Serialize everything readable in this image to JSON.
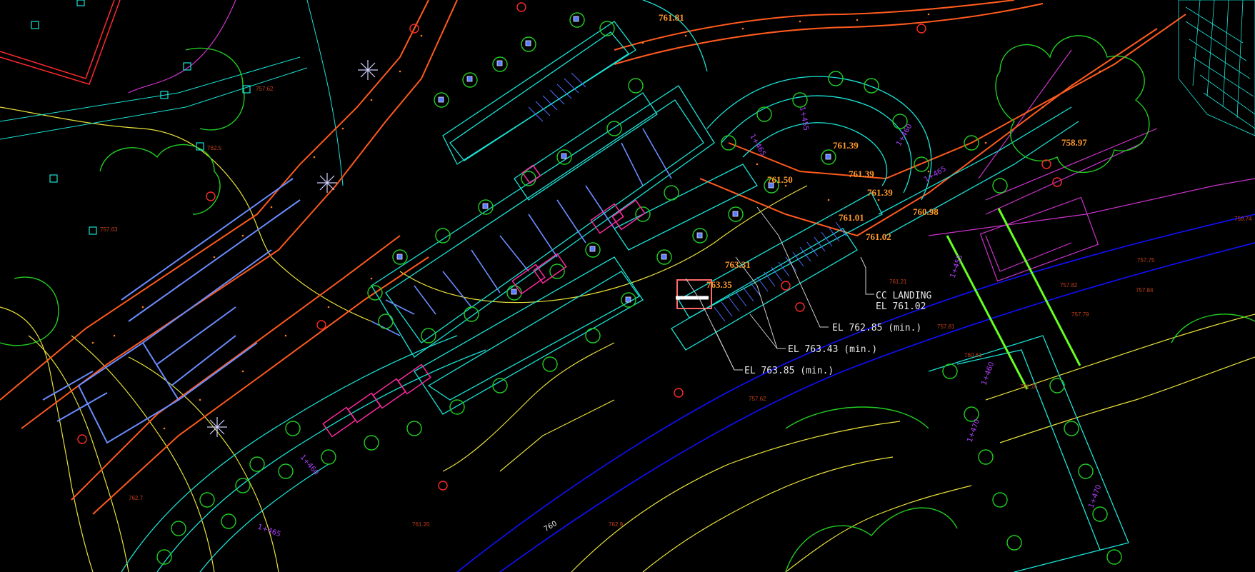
{
  "drawing": {
    "colors": {
      "background": "#000000",
      "cyan": "#19e3d6",
      "green": "#22cc22",
      "blue": "#5a7bff",
      "yellow": "#e8e03a",
      "red": "#ff2a2a",
      "orange": "#ff8a1e",
      "magenta": "#cc33cc",
      "pink": "#ff2aa0",
      "lime": "#66ff22",
      "white": "#e6e6e6",
      "darkblue": "#1010ff"
    },
    "spot_elevations": [
      "761.81",
      "761.39",
      "761.39",
      "761.39",
      "761.50",
      "761.01",
      "761.02",
      "760.98",
      "758.97",
      "763.31",
      "763.35"
    ],
    "callouts": {
      "cc_landing": "CC LANDING",
      "cc_landing_el": "EL 761.02",
      "el_1": "EL 762.85 (min.)",
      "el_2": "EL 763.43 (min.)",
      "el_3": "EL 763.85 (min.)"
    },
    "contour_label": "760",
    "small_labels": [
      "758.74",
      "757.75",
      "757.82",
      "757.84",
      "757.79",
      "757.81",
      "761.21",
      "760.61",
      "761.16",
      "762.5",
      "757.62",
      "757.63",
      "757.62",
      "762.9",
      "762.7",
      "761.20"
    ],
    "stations": [
      "1+465",
      "1+455",
      "1+460",
      "1+465",
      "1+470",
      "1+460",
      "1+455",
      "1+460",
      "1+465",
      "1+470"
    ]
  }
}
